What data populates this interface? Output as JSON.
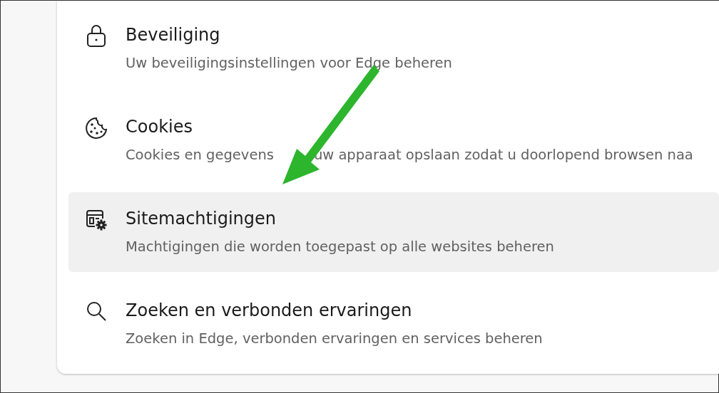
{
  "settings_items": [
    {
      "kind": "lock",
      "title": "Beveiliging",
      "description": [
        "Uw beveiligingsinstellingen voor Edge beheren"
      ],
      "selected": false
    },
    {
      "kind": "cookie",
      "title": "Cookies",
      "description": [
        "Cookies en gegevens",
        "uw apparaat opslaan zodat u doorlopend browsen naa"
      ],
      "selected": false
    },
    {
      "kind": "site-permissions",
      "title": "Sitemachtigingen",
      "description": [
        "Machtigingen die worden toegepast op alle websites beheren"
      ],
      "selected": true
    },
    {
      "kind": "search",
      "title": "Zoeken en verbonden ervaringen",
      "description": [
        "Zoeken in Edge, verbonden ervaringen en services beheren"
      ],
      "selected": false
    }
  ]
}
